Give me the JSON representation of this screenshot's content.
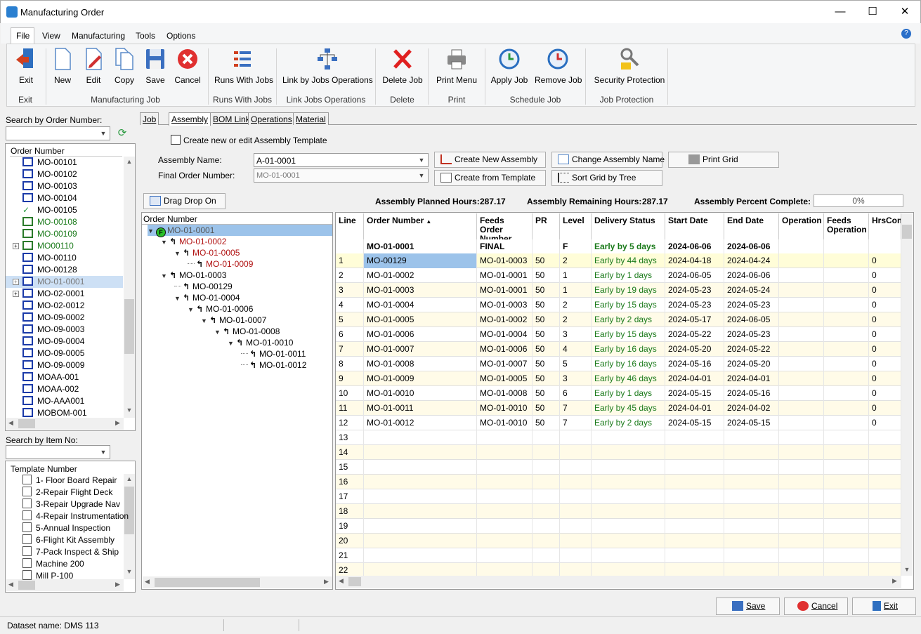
{
  "window": {
    "title": "Manufacturing Order",
    "min": "—",
    "max": "☐",
    "close": "✕"
  },
  "menu": [
    "File",
    "View",
    "Manufacturing",
    "Tools",
    "Options"
  ],
  "ribbon": {
    "buttons": [
      "Exit",
      "New",
      "Edit",
      "Copy",
      "Save",
      "Cancel",
      "Runs With Jobs",
      "Link by Jobs Operations",
      "Delete Job",
      "Print Menu",
      "Apply Job",
      "Remove Job",
      "Security Protection"
    ],
    "groups": [
      "Exit",
      "Manufacturing Job",
      "Runs With Jobs",
      "Link Jobs Operations",
      "Delete",
      "Print",
      "Schedule Job",
      "Job Protection"
    ]
  },
  "left": {
    "search_label": "Search by Order Number:",
    "order_header": "Order Number",
    "orders": [
      "MO-00101",
      "MO-00102",
      "MO-00103",
      "MO-00104",
      "MO-00105",
      "MO-00108",
      "MO-00109",
      "MO00110",
      "MO-00110",
      "MO-00128",
      "MO-01-0001",
      "MO-02-0001",
      "MO-02-0012",
      "MO-09-0002",
      "MO-09-0003",
      "MO-09-0004",
      "MO-09-0005",
      "MO-09-0009",
      "MOAA-001",
      "MOAA-002",
      "MO-AAA001",
      "MOBOM-001"
    ],
    "item_search_label": "Search by Item No:",
    "template_header": "Template Number",
    "templates": [
      "1- Floor Board Repair",
      "2-Repair Flight Deck",
      "3-Repair Upgrade Nav",
      "4-Repair Instrumentation",
      "5-Annual Inspection",
      "6-Flight Kit Assembly",
      "7-Pack Inspect & Ship",
      "Machine 200",
      "Mill P-100"
    ]
  },
  "tabs": [
    "Job",
    "Assembly",
    "BOM Link",
    "Operations",
    "Material"
  ],
  "assembly": {
    "template_checkbox": "Create new or edit Assembly Template",
    "name_label": "Assembly Name:",
    "name_value": "A-01-0001",
    "final_label": "Final Order Number:",
    "final_value": "MO-01-0001",
    "btn_create_new": "Create New Assembly",
    "btn_change_name": "Change Assembly Name",
    "btn_print_grid": "Print Grid",
    "btn_from_template": "Create from Template",
    "btn_sort_tree": "Sort Grid by Tree",
    "btn_drag_drop": "Drag Drop On",
    "planned_label": "Assembly Planned Hours:",
    "planned_value": "287.17",
    "remaining_label": "Assembly Remaining Hours:",
    "remaining_value": "287.17",
    "percent_label": "Assembly Percent Complete:",
    "percent_value": "0%"
  },
  "tree": {
    "header": "Order Number",
    "badge": "F",
    "nodes": [
      "MO-01-0001",
      "MO-01-0002",
      "MO-01-0005",
      "MO-01-0009",
      "MO-01-0003",
      "MO-00129",
      "MO-01-0004",
      "MO-01-0006",
      "MO-01-0007",
      "MO-01-0008",
      "MO-01-0010",
      "MO-01-0011",
      "MO-01-0012"
    ]
  },
  "grid": {
    "headers": [
      "Line",
      "Order Number",
      "Feeds Order Number",
      "PR",
      "Level",
      "Delivery Status",
      "Start Date",
      "End Date",
      "Operation",
      "Feeds Operation",
      "HrsCom"
    ],
    "sort_indicator": "▲",
    "summary": {
      "order": "MO-01-0001",
      "feeds": "FINAL",
      "level": "F",
      "status": "Early by 5 days",
      "start": "2024-06-06",
      "end": "2024-06-06"
    },
    "rows": [
      {
        "line": "1",
        "order": "MO-00129",
        "feeds": "MO-01-0003",
        "pr": "50",
        "level": "2",
        "status": "Early by 44 days",
        "start": "2024-04-18",
        "end": "2024-04-24",
        "hrs": "0"
      },
      {
        "line": "2",
        "order": "MO-01-0002",
        "feeds": "MO-01-0001",
        "pr": "50",
        "level": "1",
        "status": "Early by 1 days",
        "start": "2024-06-05",
        "end": "2024-06-06",
        "hrs": "0"
      },
      {
        "line": "3",
        "order": "MO-01-0003",
        "feeds": "MO-01-0001",
        "pr": "50",
        "level": "1",
        "status": "Early by 19 days",
        "start": "2024-05-23",
        "end": "2024-05-24",
        "hrs": "0"
      },
      {
        "line": "4",
        "order": "MO-01-0004",
        "feeds": "MO-01-0003",
        "pr": "50",
        "level": "2",
        "status": "Early by 15 days",
        "start": "2024-05-23",
        "end": "2024-05-23",
        "hrs": "0"
      },
      {
        "line": "5",
        "order": "MO-01-0005",
        "feeds": "MO-01-0002",
        "pr": "50",
        "level": "2",
        "status": "Early by 2 days",
        "start": "2024-05-17",
        "end": "2024-06-05",
        "hrs": "0"
      },
      {
        "line": "6",
        "order": "MO-01-0006",
        "feeds": "MO-01-0004",
        "pr": "50",
        "level": "3",
        "status": "Early by 15 days",
        "start": "2024-05-22",
        "end": "2024-05-23",
        "hrs": "0"
      },
      {
        "line": "7",
        "order": "MO-01-0007",
        "feeds": "MO-01-0006",
        "pr": "50",
        "level": "4",
        "status": "Early by 16 days",
        "start": "2024-05-20",
        "end": "2024-05-22",
        "hrs": "0"
      },
      {
        "line": "8",
        "order": "MO-01-0008",
        "feeds": "MO-01-0007",
        "pr": "50",
        "level": "5",
        "status": "Early by 16 days",
        "start": "2024-05-16",
        "end": "2024-05-20",
        "hrs": "0"
      },
      {
        "line": "9",
        "order": "MO-01-0009",
        "feeds": "MO-01-0005",
        "pr": "50",
        "level": "3",
        "status": "Early by 46 days",
        "start": "2024-04-01",
        "end": "2024-04-01",
        "hrs": "0"
      },
      {
        "line": "10",
        "order": "MO-01-0010",
        "feeds": "MO-01-0008",
        "pr": "50",
        "level": "6",
        "status": "Early by 1 days",
        "start": "2024-05-15",
        "end": "2024-05-16",
        "hrs": "0"
      },
      {
        "line": "11",
        "order": "MO-01-0011",
        "feeds": "MO-01-0010",
        "pr": "50",
        "level": "7",
        "status": "Early by 45 days",
        "start": "2024-04-01",
        "end": "2024-04-02",
        "hrs": "0"
      },
      {
        "line": "12",
        "order": "MO-01-0012",
        "feeds": "MO-01-0010",
        "pr": "50",
        "level": "7",
        "status": "Early by 2 days",
        "start": "2024-05-15",
        "end": "2024-05-15",
        "hrs": "0"
      }
    ],
    "empty_lines": [
      "13",
      "14",
      "15",
      "16",
      "17",
      "18",
      "19",
      "20",
      "21",
      "22"
    ]
  },
  "footer": {
    "save": "Save",
    "cancel": "Cancel",
    "exit": "Exit"
  },
  "status": {
    "dataset": "Dataset name:  DMS 113"
  }
}
